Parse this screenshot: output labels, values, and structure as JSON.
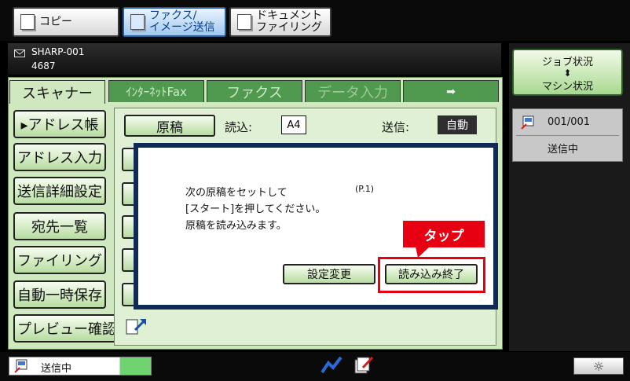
{
  "mode_tabs": [
    {
      "label": "コピー",
      "active": false
    },
    {
      "label": "ファクス/\nイメージ送信",
      "active": true
    },
    {
      "label": "ドキュメント\nファイリング",
      "active": false
    }
  ],
  "status": {
    "device": "SHARP-001",
    "number": "4687"
  },
  "tabs": [
    "スキャナー",
    "ｲﾝﾀｰﾈｯﾄFax",
    "ファクス",
    "データ入力"
  ],
  "tab_next_arrow": "➡",
  "sidebar": [
    "▸アドレス帳",
    "アドレス入力",
    "送信詳細設定",
    "宛先一覧",
    "ファイリング",
    "自動一時保存",
    "プレビュー確認"
  ],
  "settings_row": {
    "original_button": "原稿",
    "read_label": "読込:",
    "read_value": "A4",
    "send_label": "送信:",
    "send_value": "自動"
  },
  "dialog": {
    "line1": "次の原稿をセットして",
    "page": "(P.1)",
    "line2": "[スタート]を押してください。",
    "line3": "原稿を読み込みます。",
    "settings_button": "設定変更",
    "finish_button": "読み込み終了"
  },
  "callout": {
    "label": "タップ",
    "color": "#e60012"
  },
  "job_status": {
    "line1": "ジョブ状況",
    "arrow": "⬍",
    "line2": "マシン状況",
    "count": "001/001",
    "state": "送信中"
  },
  "bottom": {
    "status_label": "送信中",
    "brightness_icon": "☼"
  }
}
